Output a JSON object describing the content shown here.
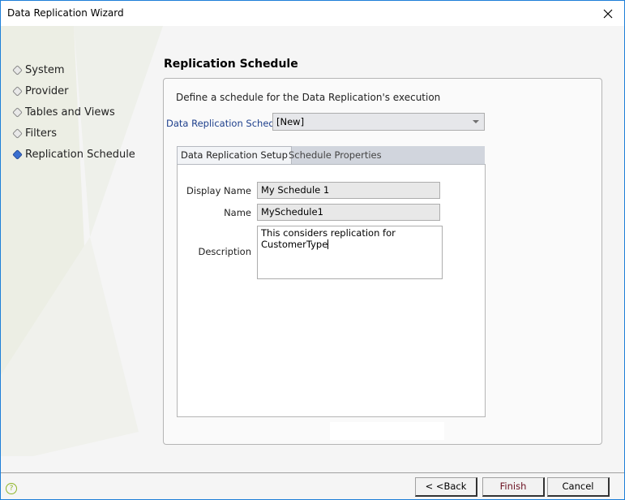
{
  "window": {
    "title": "Data Replication Wizard",
    "close_icon": "close-x-icon"
  },
  "sidebar": {
    "steps": [
      {
        "label": "System",
        "active": false
      },
      {
        "label": "Provider",
        "active": false
      },
      {
        "label": "Tables and Views",
        "active": false
      },
      {
        "label": "Filters",
        "active": false
      },
      {
        "label": "Replication Schedule",
        "active": true
      }
    ]
  },
  "main": {
    "title": "Replication Schedule",
    "intro": "Define a schedule for the Data Replication's execution",
    "schedule_label": "Data Replication Schedu",
    "schedule_value": "[New]",
    "tabs": [
      {
        "label": "Data Replication Setup",
        "active": true
      },
      {
        "label": "Schedule Properties",
        "active": false
      }
    ],
    "form": {
      "display_name_label": "Display Name",
      "display_name_value": "My Schedule 1",
      "name_label": "Name",
      "name_value": "MySchedule1",
      "description_label": "Description",
      "description_value": "This considers replication for CustomerType"
    }
  },
  "footer": {
    "help_icon": "help-circle-icon",
    "back_label": "< <Back",
    "finish_label": "Finish",
    "cancel_label": "Cancel"
  },
  "colors": {
    "window_border": "#1e7fd8",
    "active_step": "#3a6fd0",
    "label_blue": "#1d3f8c",
    "finish_text": "#6b1020",
    "help_green": "#8fb52a"
  }
}
